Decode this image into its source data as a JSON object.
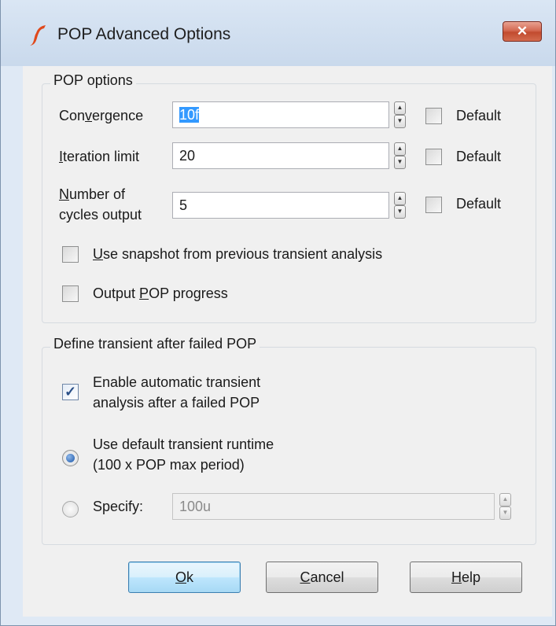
{
  "window": {
    "title": "POP Advanced Options",
    "close_label": "✕"
  },
  "pop_options": {
    "group_label": "POP options",
    "convergence": {
      "label_pre": "Con",
      "mnemonic": "v",
      "label_post": "ergence",
      "value": "10f",
      "default_label": "Default",
      "default_checked": false
    },
    "iteration_limit": {
      "label_pre": "",
      "mnemonic": "I",
      "label_post": "teration limit",
      "value": "20",
      "default_label": "Default",
      "default_checked": false
    },
    "cycles_output": {
      "label_line1_mnemonic": "N",
      "label_line1_rest": "umber of",
      "label_line2": "cycles output",
      "value": "5",
      "default_label": "Default",
      "default_checked": false
    },
    "use_snapshot": {
      "mnemonic": "U",
      "label_rest": "se snapshot from previous transient analysis",
      "checked": false
    },
    "output_progress": {
      "label_pre": "Output ",
      "mnemonic": "P",
      "label_post": "OP progress",
      "checked": false
    }
  },
  "transient": {
    "group_label": "Define transient after failed POP",
    "enable_auto": {
      "line1": "Enable automatic transient",
      "line2": "analysis after a failed POP",
      "checked": true
    },
    "use_default_runtime": {
      "line1": "Use default transient runtime",
      "line2": "(100 x POP max period)",
      "selected": true
    },
    "specify": {
      "label": "Specify:",
      "value": "100u",
      "selected": false
    }
  },
  "buttons": {
    "ok": {
      "mnemonic": "O",
      "rest": "k"
    },
    "cancel": {
      "mnemonic": "C",
      "rest": "ancel"
    },
    "help": {
      "mnemonic": "H",
      "rest": "elp"
    }
  },
  "colors": {
    "selection": "#3399ff",
    "close_button": "#c24b2f",
    "client_bg": "#f0f0f0"
  },
  "icons": {
    "app": "simetrix-logo-icon",
    "close": "close-icon",
    "spin": "spin-updown-icon",
    "check": "checkmark-icon"
  }
}
